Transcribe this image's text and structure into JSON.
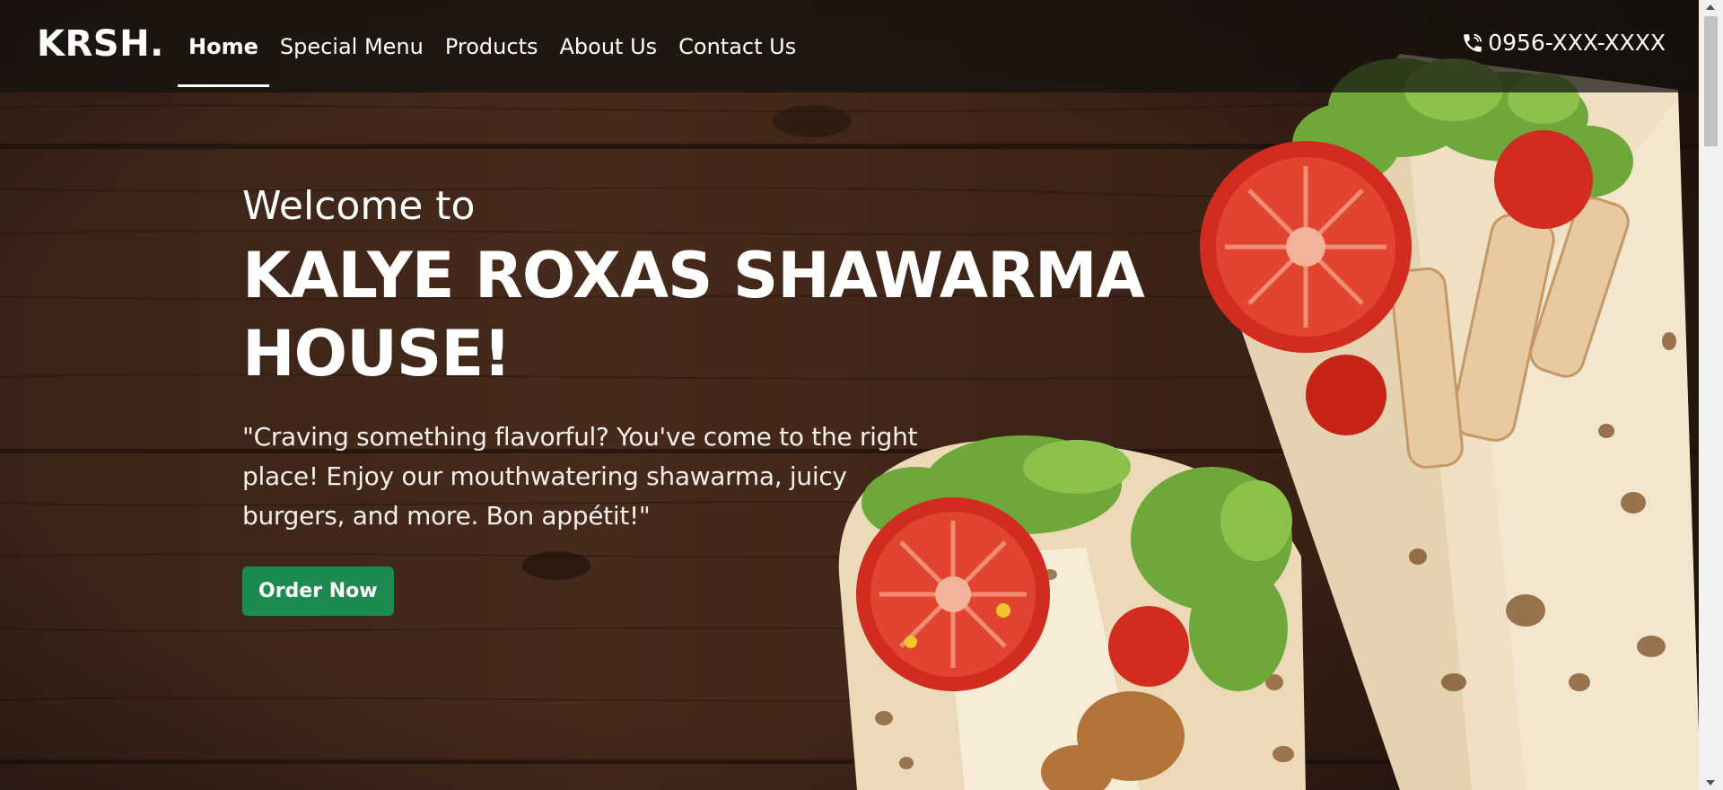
{
  "nav": {
    "brand": "KRSH.",
    "links": [
      {
        "label": "Home",
        "active": true
      },
      {
        "label": "Special Menu",
        "active": false
      },
      {
        "label": "Products",
        "active": false
      },
      {
        "label": "About Us",
        "active": false
      },
      {
        "label": "Contact Us",
        "active": false
      }
    ],
    "phone": "0956-XXX-XXXX",
    "phone_icon": "phone-icon"
  },
  "hero": {
    "welcome": "Welcome to",
    "title": "KALYE ROXAS SHAWARMA HOUSE!",
    "tagline": "\"Craving something flavorful? You've come to the right place! Enjoy our mouthwatering shawarma, juicy burgers, and more. Bon appétit!\"",
    "cta_label": "Order Now"
  },
  "colors": {
    "accent": "#1d8a50",
    "wood_dark": "#2b1a12",
    "wood_light": "#4a2d1e",
    "nav_bg": "#141010"
  }
}
